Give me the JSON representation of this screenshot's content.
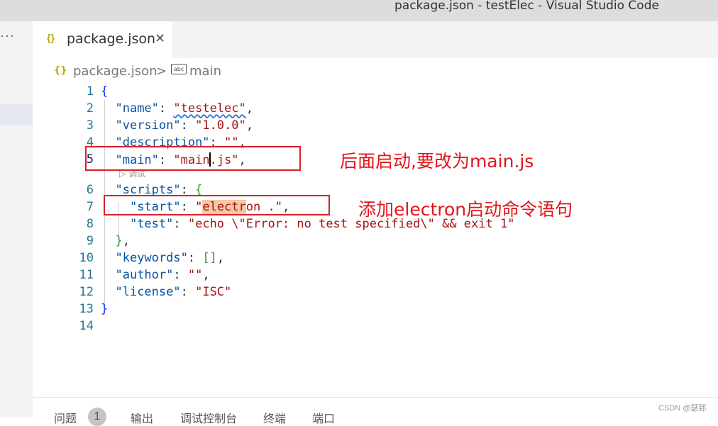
{
  "window": {
    "title": "package.json - testElec - Visual Studio Code"
  },
  "activitybar": {
    "more_label": "···"
  },
  "tab": {
    "icon": "{}",
    "label": "package.json",
    "close": "✕"
  },
  "breadcrumb": {
    "file": "package.json",
    "separator": ">",
    "symbol_icon": "abc",
    "symbol": "main"
  },
  "codelens": {
    "label": "调试"
  },
  "lines": {
    "n1": "1",
    "n2": "2",
    "n3": "3",
    "n4": "4",
    "n5": "5",
    "n6": "6",
    "n7": "7",
    "n8": "8",
    "n9": "9",
    "n10": "10",
    "n11": "11",
    "n12": "12",
    "n13": "13",
    "n14": "14"
  },
  "code": {
    "l2_key": "\"name\"",
    "l2_val": "\"testelec\"",
    "l3_key": "\"version\"",
    "l3_val": "\"1.0.0\"",
    "l4_key": "\"description\"",
    "l4_val": "\"\"",
    "l5_key": "\"main\"",
    "l5_val_a": "\"main",
    "l5_val_b": ".js\"",
    "l6_key": "\"scripts\"",
    "l7_key": "\"start\"",
    "l7_val_a": "\"",
    "l7_val_hl": "electr",
    "l7_val_b": "on .\"",
    "l8_key": "\"test\"",
    "l8_val": "\"echo \\\"Error: no test specified\\\" && exit 1\"",
    "l10_key": "\"keywords\"",
    "l11_key": "\"author\"",
    "l11_val": "\"\"",
    "l12_key": "\"license\"",
    "l12_val": "\"ISC\""
  },
  "annotations": {
    "note1": "后面启动,要改为main.js",
    "note2": "添加electron启动命令语句"
  },
  "panel": {
    "tabs": [
      "问题",
      "输出",
      "调试控制台",
      "终端",
      "端口"
    ],
    "problems_count": "1"
  },
  "watermark": "CSDN @瑟郅",
  "colors": {
    "annotation_red": "#d9202a",
    "key": "#0451a5",
    "string": "#a31515"
  }
}
